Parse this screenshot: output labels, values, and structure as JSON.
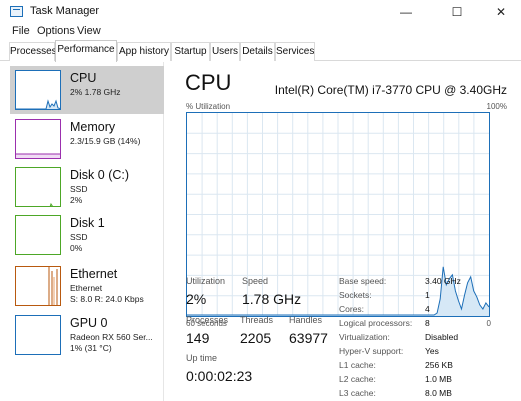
{
  "window": {
    "title": "Task Manager",
    "minimize_glyph": "—",
    "maximize_glyph": "☐",
    "close_glyph": "✕"
  },
  "menu": [
    "File",
    "Options",
    "View"
  ],
  "tabs": [
    "Processes",
    "Performance",
    "App history",
    "Startup",
    "Users",
    "Details",
    "Services"
  ],
  "active_tab": "Performance",
  "sidebar": {
    "items": [
      {
        "name": "CPU",
        "line2": "2% 1.78 GHz",
        "line3": "",
        "color": "#1d6fb8"
      },
      {
        "name": "Memory",
        "line2": "2.3/15.9 GB (14%)",
        "line3": "",
        "color": "#9b2fae"
      },
      {
        "name": "Disk 0 (C:)",
        "line2": "SSD",
        "line3": "2%",
        "color": "#4da727"
      },
      {
        "name": "Disk 1",
        "line2": "SSD",
        "line3": "0%",
        "color": "#4da727"
      },
      {
        "name": "Ethernet",
        "line2": "Ethernet",
        "line3": "S: 8.0  R: 24.0 Kbps",
        "color": "#b8590f"
      },
      {
        "name": "GPU 0",
        "line2": "Radeon RX 560 Ser...",
        "line3": "1% (31 °C)",
        "color": "#1d6fb8"
      }
    ]
  },
  "main": {
    "title": "CPU",
    "model": "Intel(R) Core(TM) i7-3770 CPU @ 3.40GHz",
    "util_label": "% Utilization",
    "util_max": "100%",
    "time_label": "60 seconds",
    "zero_label": "0",
    "stats": {
      "utilization_label": "Utilization",
      "utilization_value": "2%",
      "speed_label": "Speed",
      "speed_value": "1.78 GHz",
      "processes_label": "Processes",
      "processes_value": "149",
      "threads_label": "Threads",
      "threads_value": "2205",
      "handles_label": "Handles",
      "handles_value": "63977",
      "uptime_label": "Up time",
      "uptime_value": "0:00:02:23"
    },
    "specs": [
      {
        "key": "Base speed:",
        "value": "3.40 GHz"
      },
      {
        "key": "Sockets:",
        "value": "1"
      },
      {
        "key": "Cores:",
        "value": "4"
      },
      {
        "key": "Logical processors:",
        "value": "8"
      },
      {
        "key": "Virtualization:",
        "value": "Disabled"
      },
      {
        "key": "Hyper-V support:",
        "value": "Yes"
      },
      {
        "key": "L1 cache:",
        "value": "256 KB"
      },
      {
        "key": "L2 cache:",
        "value": "1.0 MB"
      },
      {
        "key": "L3 cache:",
        "value": "8.0 MB"
      }
    ]
  },
  "graph": {
    "color": "#1d6fb8",
    "fill": "#d6e8f6",
    "grid": "#dbe7f1",
    "points": [
      0,
      0,
      0,
      0,
      0,
      0,
      0,
      0,
      0,
      0,
      0,
      0,
      0,
      0,
      0,
      0,
      0,
      0,
      0,
      0,
      0,
      0,
      0,
      0,
      0,
      0,
      0,
      0,
      0,
      0,
      0,
      0,
      0,
      0,
      0,
      0,
      0,
      0,
      0,
      0,
      0,
      0,
      0,
      0,
      0,
      0,
      0,
      0,
      0,
      0,
      0,
      0,
      0,
      0,
      0,
      0,
      0,
      0,
      0,
      0,
      0,
      0,
      0,
      0,
      0,
      0,
      0,
      0,
      0,
      0,
      0,
      0,
      0,
      0,
      0,
      0,
      0,
      0,
      0,
      0,
      0,
      0,
      1,
      8,
      24,
      15,
      18,
      20,
      12,
      7,
      3,
      10,
      16,
      19,
      12,
      9,
      5,
      3,
      6,
      4
    ]
  }
}
